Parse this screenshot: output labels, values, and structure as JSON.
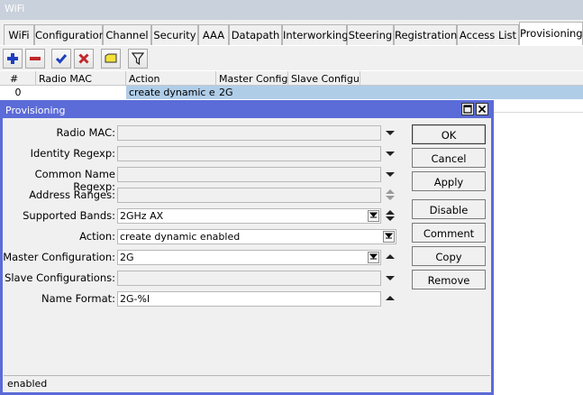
{
  "window": {
    "title": "WiFi"
  },
  "tabs": [
    {
      "label": "WiFi"
    },
    {
      "label": "Configuration"
    },
    {
      "label": "Channel"
    },
    {
      "label": "Security"
    },
    {
      "label": "AAA"
    },
    {
      "label": "Datapath"
    },
    {
      "label": "Interworking"
    },
    {
      "label": "Steering"
    },
    {
      "label": "Registration"
    },
    {
      "label": "Access List"
    },
    {
      "label": "Provisioning"
    }
  ],
  "active_tab": "Provisioning",
  "toolbar": {
    "icons": [
      "plus-icon",
      "minus-icon",
      "check-icon",
      "cross-icon",
      "comment-icon",
      "filter-icon"
    ]
  },
  "table": {
    "headers": [
      "#",
      "Radio MAC",
      "Action",
      "Master Config...",
      "Slave Configu..."
    ],
    "rows": [
      {
        "num": "0",
        "radio_mac": "",
        "action": "create dynamic e...",
        "master": "2G",
        "slave": ""
      }
    ]
  },
  "dialog": {
    "title": "Provisioning",
    "fields": [
      {
        "label": "Radio MAC:",
        "value": ""
      },
      {
        "label": "Identity Regexp:",
        "value": ""
      },
      {
        "label": "Common Name Regexp:",
        "value": ""
      },
      {
        "label": "Address Ranges:",
        "value": ""
      },
      {
        "label": "Supported Bands:",
        "value": "2GHz AX"
      },
      {
        "label": "Action:",
        "value": "create dynamic enabled"
      },
      {
        "label": "Master Configuration:",
        "value": "2G"
      },
      {
        "label": "Slave Configurations:",
        "value": ""
      },
      {
        "label": "Name Format:",
        "value": "2G-%I"
      }
    ],
    "buttons": {
      "ok": "OK",
      "cancel": "Cancel",
      "apply": "Apply",
      "disable": "Disable",
      "comment": "Comment",
      "copy": "Copy",
      "remove": "Remove"
    },
    "status": "enabled"
  },
  "colors": {
    "dialog_title_bar": "#5b6bd8",
    "selected_row": "#b0cde8",
    "add_icon": "#1f3fbf",
    "remove_icon": "#c0282c"
  }
}
